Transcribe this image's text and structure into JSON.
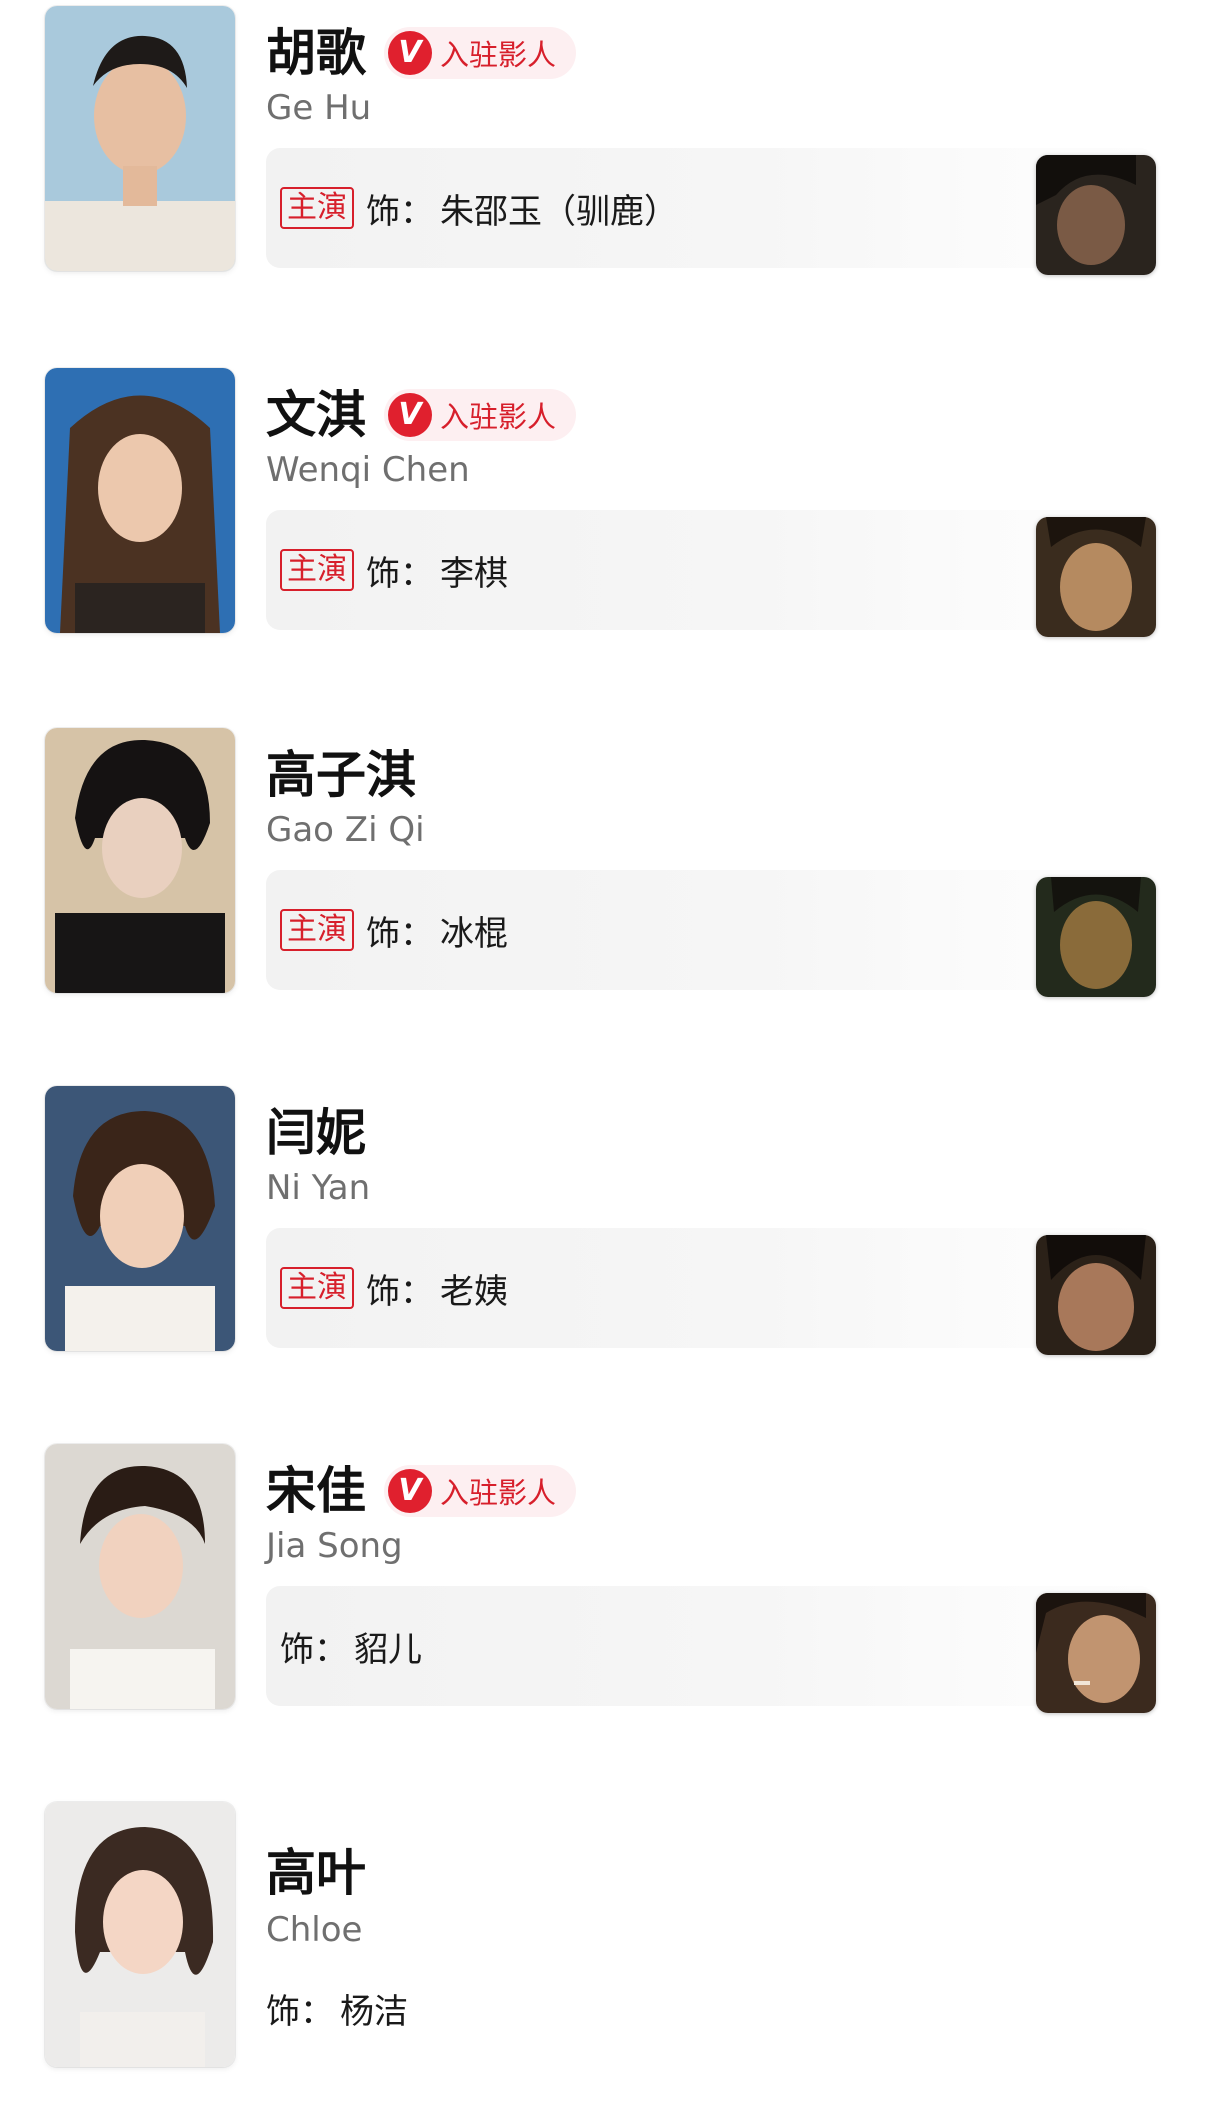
{
  "cast": [
    {
      "cn_name": "胡歌",
      "en_name": "Ge Hu",
      "verified": true,
      "badge_text": "入驻影人",
      "lead": true,
      "lead_label": "主演",
      "role_prefix": "饰：",
      "role": "朱邵玉（驯鹿）"
    },
    {
      "cn_name": "文淇",
      "en_name": "Wenqi Chen",
      "verified": true,
      "badge_text": "入驻影人",
      "lead": true,
      "lead_label": "主演",
      "role_prefix": "饰：",
      "role": "李棋"
    },
    {
      "cn_name": "高子淇",
      "en_name": "Gao Zi Qi",
      "verified": false,
      "lead": true,
      "lead_label": "主演",
      "role_prefix": "饰：",
      "role": "冰棍"
    },
    {
      "cn_name": "闫妮",
      "en_name": "Ni Yan",
      "verified": false,
      "lead": true,
      "lead_label": "主演",
      "role_prefix": "饰：",
      "role": "老姨"
    },
    {
      "cn_name": "宋佳",
      "en_name": "Jia Song",
      "verified": true,
      "badge_text": "入驻影人",
      "lead": false,
      "role_prefix": "饰：",
      "role": "貂儿"
    },
    {
      "cn_name": "高叶",
      "en_name": "Chloe",
      "verified": false,
      "lead": false,
      "role_prefix": "饰：",
      "role": "杨洁"
    }
  ],
  "colors": {
    "accent_red": "#e0202e",
    "badge_bg": "#fdeff1",
    "name_text": "#111111",
    "subtitle_text": "#6f6f6f",
    "card_bg": "#f2f2f2"
  },
  "icons": {
    "verified": "verified-v-icon"
  }
}
